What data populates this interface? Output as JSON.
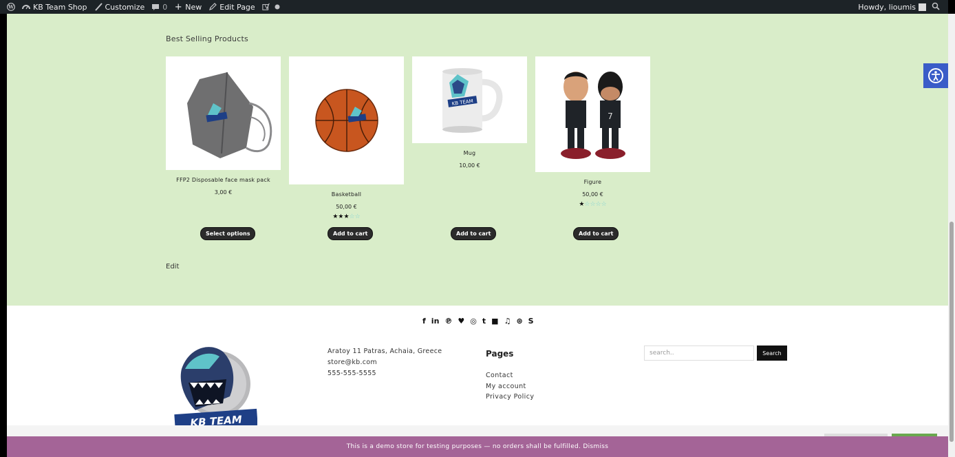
{
  "adminbar": {
    "site_name": "KB Team Shop",
    "customize": "Customize",
    "comments_count": "0",
    "new": "New",
    "edit_page": "Edit Page",
    "greeting": "Howdy, lioumis"
  },
  "main": {
    "section_title": "Best Selling Products",
    "edit_link": "Edit",
    "products": [
      {
        "name": "FFP2 Disposable face mask pack",
        "price": "3,00 €",
        "button": "Select options",
        "rating": null
      },
      {
        "name": "Basketball",
        "price": "50,00 €",
        "button": "Add to cart",
        "rating": 3
      },
      {
        "name": "Mug",
        "price": "10,00 €",
        "button": "Add to cart",
        "rating": null
      },
      {
        "name": "Figure",
        "price": "50,00 €",
        "button": "Add to cart",
        "rating": 1
      }
    ]
  },
  "footer": {
    "social_icons": [
      "facebook-icon",
      "linkedin-icon",
      "pinterest-icon",
      "twitter-icon",
      "instagram-icon",
      "tumblr-icon",
      "youtube-icon",
      "soundcloud-icon",
      "dribbble-icon",
      "skype-icon"
    ],
    "address": {
      "line1": "Aratoy 11 Patras, Achaia, Greece",
      "line2": "store@kb.com",
      "line3": "555-555-5555"
    },
    "pages_title": "Pages",
    "pages": [
      "Contact",
      "My account",
      "Privacy Policy"
    ],
    "search_placeholder": "search..",
    "search_button": "Search",
    "logo_text": "KB TEAM"
  },
  "demo_notice": "This is a demo store for testing purposes — no orders shall be fulfilled. Dismiss",
  "colors": {
    "adminbar": "#1d2327",
    "main_bg": "#d9edc9",
    "demo_bar": "#a46497",
    "button": "#2b2b2b",
    "a11y": "#3a5cc8"
  }
}
